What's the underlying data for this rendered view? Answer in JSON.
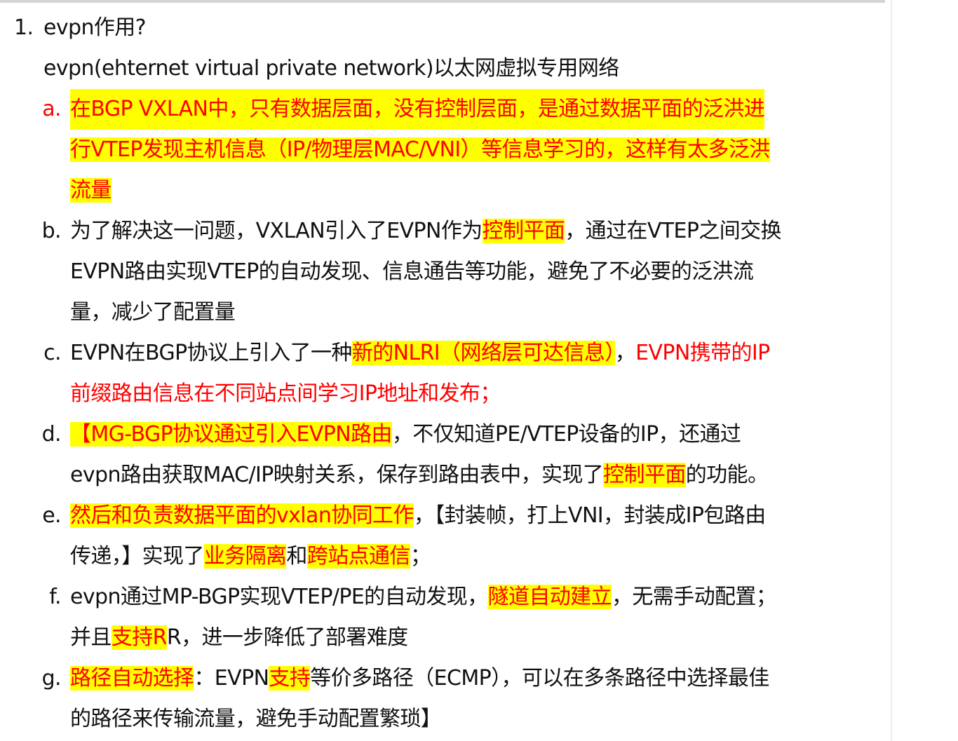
{
  "item": {
    "number": "1.",
    "question": "evpn作用?",
    "definition": "evpn(ehternet virtual private network)以太网虚拟专用网络"
  },
  "points": {
    "a": {
      "marker": "a.",
      "l1": "在BGP VXLAN中，只有数据层面，没有控制层面，是通过数据平面的泛洪进",
      "l2": "行VTEP发现主机信息（IP/物理层MAC/VNI）等信息学习的，这样有太多泛洪",
      "l3": "流量"
    },
    "b": {
      "marker": "b.",
      "l1a": "为了解决这一问题，VXLAN引入了EVPN作为",
      "l1b": "控制平面",
      "l1c": "，通过在VTEP之间交换",
      "l2": "EVPN路由实现VTEP的自动发现、信息通告等功能，避免了不必要的泛洪流",
      "l3": "量，减少了配置量"
    },
    "c": {
      "marker": "c.",
      "l1a": "EVPN在BGP协议上引入了一种",
      "l1b": "新的NLRI（网络层可达信息）",
      "l1c": "，",
      "l1d": "EVPN携带的IP",
      "l2": "前缀路由信息在不同站点间学习IP地址和发布；"
    },
    "d": {
      "marker": "d.",
      "l1a": "【MG-BGP协议通过引入EVPN路由",
      "l1b": "，不仅知道PE/VTEP设备的IP，还通过",
      "l2a": "evpn路由获取MAC/IP映射关系，保存到路由表中，实现了",
      "l2b": "控制平面",
      "l2c": "的功能。"
    },
    "e": {
      "marker": "e.",
      "l1a": "然后和负责数据平面的vxlan协同工作",
      "l1b": "，【封装帧，打上VNI，封装成IP包路由",
      "l2a": "传递，】实现了",
      "l2b": "业务隔离",
      "l2c": "和",
      "l2d": "跨站点通信",
      "l2e": "；"
    },
    "f": {
      "marker": "f.",
      "l1a": "evpn通过MP-BGP实现VTEP/PE的自动发现，",
      "l1b": "隧道自动建立",
      "l1c": "，无需手动配置；",
      "l2a": "并且",
      "l2b": "支持R",
      "l2c": "R，进一步降低了部署难度"
    },
    "g": {
      "marker": "g.",
      "l1a": "路径自动选择",
      "l1b": "：EVPN",
      "l1c": "支持",
      "l1d": "等价多路径（ECMP），可以在多条路径中选择最佳",
      "l2": "的路径来传输流量，避免手动配置繁琐】"
    }
  },
  "colors": {
    "highlight": "#ffff00",
    "emphasis_text": "#ff0000",
    "body_text": "#111111"
  }
}
